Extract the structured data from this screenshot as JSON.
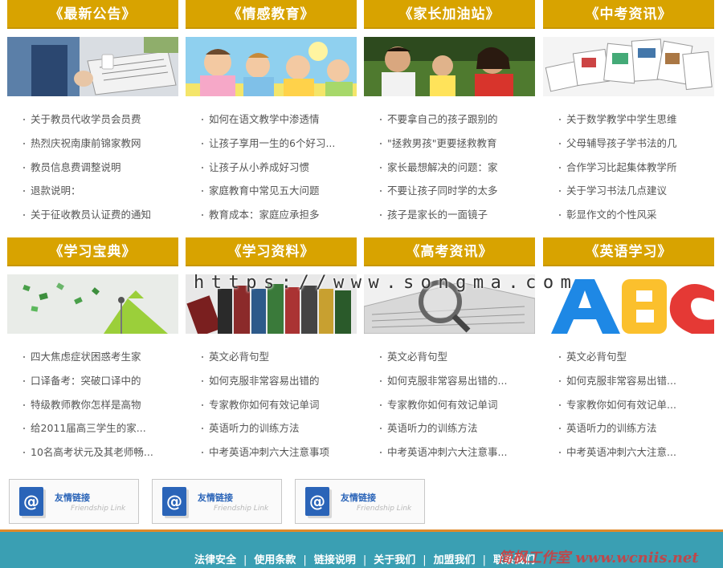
{
  "sections": [
    {
      "title": "《最新公告》",
      "image": "businessman-newspaper",
      "items": [
        "关于教员代收学员会员费",
        "热烈庆祝南康前锦家教网",
        "教员信息费调整说明",
        "退款说明：",
        "关于征收教员认证费的通知"
      ]
    },
    {
      "title": "《情感教育》",
      "image": "smiling-children",
      "items": [
        "如何在语文教学中渗透情",
        "让孩子享用一生的6个好习...",
        "让孩子从小养成好习惯",
        "家庭教育中常见五大问题",
        "教育成本：家庭应承担多"
      ]
    },
    {
      "title": "《家长加油站》",
      "image": "parents-with-child",
      "items": [
        "不要拿自己的孩子跟别的",
        "\"拯救男孩\"更要拯救教育",
        "家长最想解决的问题：家",
        "不要让孩子同时学的太多",
        "孩子是家长的一面镜子"
      ]
    },
    {
      "title": "《中考资讯》",
      "image": "scattered-papers",
      "items": [
        "关于数学教学中学生思维",
        "父母辅导孩子学书法的几",
        "合作学习比起集体教学所",
        "关于学习书法几点建议",
        "彰显作文的个性风采"
      ]
    },
    {
      "title": "《学习宝典》",
      "image": "green-arrow",
      "items": [
        "四大焦虑症状困惑考生家",
        "口译备考：突破口译中的",
        "特级教师教你怎样是高物",
        "给2011届高三学生的家...",
        "10名高考状元及其老师畅..."
      ]
    },
    {
      "title": "《学习资料》",
      "image": "book-spines",
      "items": [
        "英文必背句型",
        "如何克服非常容易出错的",
        "专家教你如何有效记单词",
        "英语听力的训练方法",
        "中考英语冲刺六大注意事项"
      ]
    },
    {
      "title": "《高考资讯》",
      "image": "newspaper-magnifier",
      "items": [
        "英文必背句型",
        "如何克服非常容易出错的...",
        "专家教你如何有效记单词",
        "英语听力的训练方法",
        "中考英语冲刺六大注意事..."
      ]
    },
    {
      "title": "《英语学习》",
      "image": "abc-letters",
      "items": [
        "英文必背句型",
        "如何克服非常容易出错...",
        "专家教你如何有效记单...",
        "英语听力的训练方法",
        "中考英语冲刺六大注意..."
      ]
    }
  ],
  "watermark": "https://www.songma.com",
  "friend_links": [
    {
      "title": "友情链接",
      "subtitle": "Friendship Link"
    },
    {
      "title": "友情链接",
      "subtitle": "Friendship Link"
    },
    {
      "title": "友情链接",
      "subtitle": "Friendship Link"
    }
  ],
  "footer": {
    "links": [
      "法律安全",
      "使用条款",
      "链接说明",
      "关于我们",
      "加盟我们",
      "联系我们"
    ],
    "separator": "|",
    "watermark": "简枫工作室 www.wcniis.net"
  },
  "colors": {
    "section_header": "#d8a300",
    "footer": "#3a9fb3",
    "footer_border": "#e08a2a"
  }
}
